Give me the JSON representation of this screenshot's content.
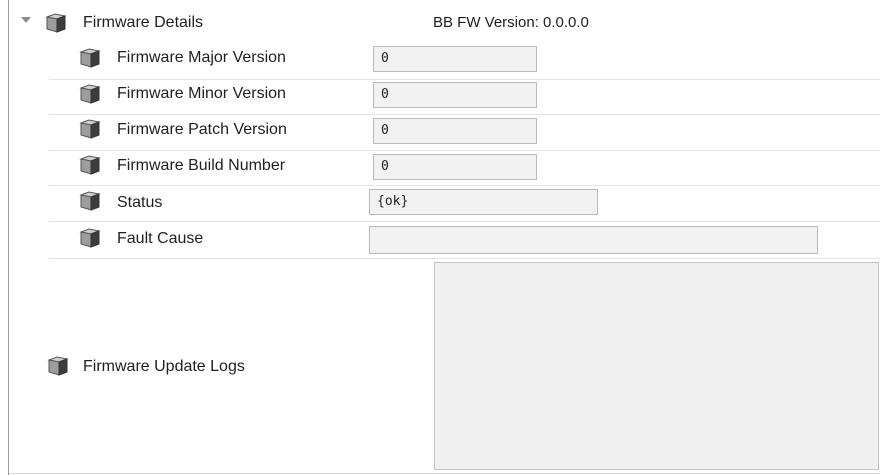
{
  "firmware_details": {
    "label": "Firmware Details",
    "bb_fw_version": "BB FW Version: 0.0.0.0"
  },
  "properties": [
    {
      "label": "Firmware Major Version",
      "value": "0"
    },
    {
      "label": "Firmware Minor Version",
      "value": "0"
    },
    {
      "label": "Firmware Patch Version",
      "value": "0"
    },
    {
      "label": "Firmware Build Number",
      "value": "0"
    },
    {
      "label": "Status",
      "value": "{ok}"
    },
    {
      "label": "Fault Cause",
      "value": ""
    }
  ],
  "logs": {
    "label": "Firmware Update Logs",
    "value": ""
  },
  "icon_name": "property-cube-icon",
  "colors": {
    "field_bg": "#f2f2f2",
    "field_border": "#b9b9b9",
    "separator": "#e4e4e4"
  }
}
